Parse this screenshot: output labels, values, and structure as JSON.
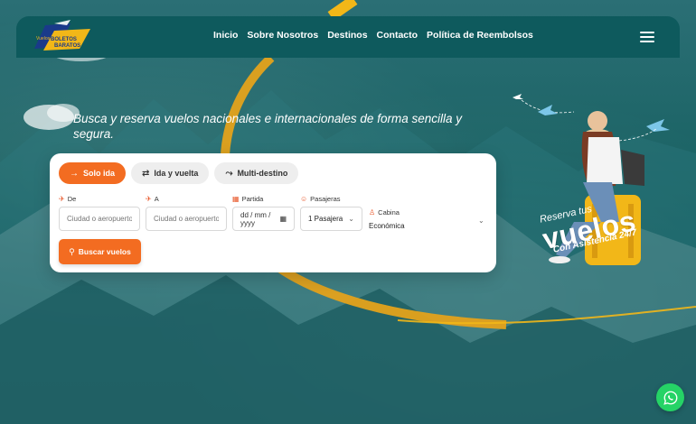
{
  "brand": {
    "logo_line1": "Vuelos",
    "logo_line2": "BOLETOS",
    "logo_line3": "BARATOS",
    "colors": {
      "accent": "#f36c21",
      "teal": "#0e5a5d",
      "yellow": "#f2b718",
      "whatsapp": "#25d366"
    }
  },
  "nav": {
    "items": [
      "Inicio",
      "Sobre Nosotros",
      "Destinos",
      "Contacto",
      "Política de Reembolsos"
    ],
    "menu_icon": "hamburger-icon"
  },
  "hero": {
    "title": "Busca y reserva vuelos nacionales e internacionales de forma sencilla y segura."
  },
  "search": {
    "tabs": [
      {
        "label": "Solo ida",
        "icon": "arrow-right-icon",
        "active": true
      },
      {
        "label": "Ida y vuelta",
        "icon": "swap-icon",
        "active": false
      },
      {
        "label": "Multi-destino",
        "icon": "route-icon",
        "active": false
      }
    ],
    "fields": {
      "from_label": "De",
      "from_placeholder": "Ciudad o aeropuerto",
      "to_label": "A",
      "to_placeholder": "Ciudad o aeropuerto",
      "date_label": "Partida",
      "date_placeholder": "dd / mm / yyyy",
      "passengers_label": "Pasajeras",
      "passengers_value": "1 Pasajera",
      "cabin_label": "Cabina",
      "cabin_value": "Económica"
    },
    "submit_label": "Buscar vuelos"
  },
  "promo": {
    "line1": "Reserva tus",
    "line2": "vuelos",
    "line3": "Con Asistencia 24/7"
  },
  "whatsapp": {
    "icon": "whatsapp-icon"
  }
}
